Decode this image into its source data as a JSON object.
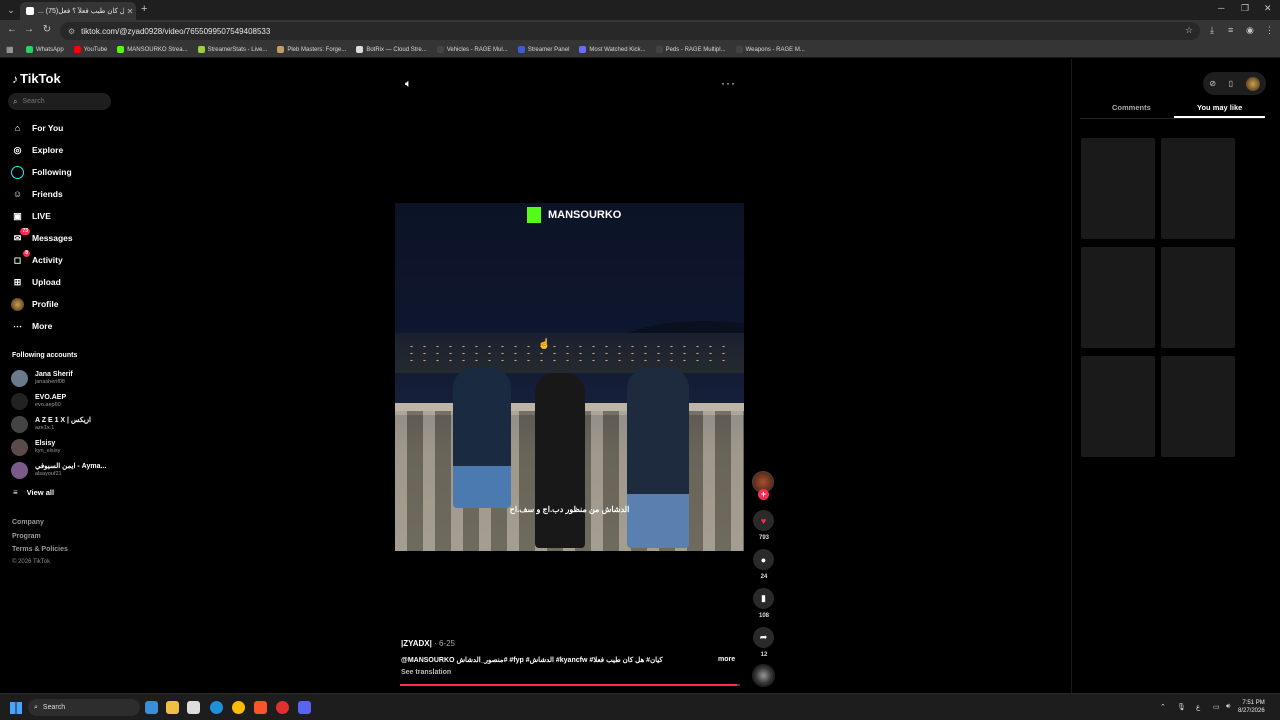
{
  "browser": {
    "tab_title": "... (75)هل كان طيب فعلاً ؟ فعل",
    "url": "tiktok.com/@zyad0928/video/7655099507549408533",
    "bookmarks": [
      {
        "label": "WhatsApp",
        "color": "#25d366"
      },
      {
        "label": "YouTube",
        "color": "#ff0000"
      },
      {
        "label": "MANSOURKO Strea...",
        "color": "#53fc18"
      },
      {
        "label": "StreamerStats - Live...",
        "color": "#9bd13a"
      },
      {
        "label": "Pleb Masters: Forge...",
        "color": "#c0a060"
      },
      {
        "label": "BotRix — Cloud Stre...",
        "color": "#dddddd"
      },
      {
        "label": "Vehicles - RAGE Mul...",
        "color": "#444444"
      },
      {
        "label": "Streamer Panel",
        "color": "#3b5bdb"
      },
      {
        "label": "Most Watched Kick...",
        "color": "#6b6bff"
      },
      {
        "label": "Peds - RAGE Multipl...",
        "color": "#444444"
      },
      {
        "label": "Weapons - RAGE M...",
        "color": "#444444"
      }
    ]
  },
  "sidebar": {
    "logo": "TikTok",
    "search_placeholder": "Search",
    "nav": [
      {
        "label": "For You",
        "icon": "home-icon"
      },
      {
        "label": "Explore",
        "icon": "compass-icon"
      },
      {
        "label": "Following",
        "icon": "following-icon"
      },
      {
        "label": "Friends",
        "icon": "friends-icon"
      },
      {
        "label": "LIVE",
        "icon": "live-icon"
      },
      {
        "label": "Messages",
        "icon": "messages-icon",
        "badge": "73"
      },
      {
        "label": "Activity",
        "icon": "activity-icon",
        "badge": "8"
      },
      {
        "label": "Upload",
        "icon": "upload-icon"
      },
      {
        "label": "Profile",
        "icon": "profile-avatar"
      },
      {
        "label": "More",
        "icon": "more-icon"
      }
    ],
    "following_title": "Following accounts",
    "accounts": [
      {
        "name": "Jana Sherif",
        "handle": "janasherif08",
        "color": "#6a7a8a"
      },
      {
        "name": "EVO.AEP",
        "handle": "evo.aep60",
        "color": "#222222"
      },
      {
        "name": "A Z E 1 X | ازيكس",
        "handle": "aze1x.1",
        "color": "#444444"
      },
      {
        "name": "Elsisy",
        "handle": "kyn_elsisy",
        "color": "#5a4a4a"
      },
      {
        "name": "ايمن السيوفي - Ayma...",
        "handle": "alsayouf21",
        "color": "#7a5a8a"
      }
    ],
    "view_all": "View all",
    "footer": [
      "Company",
      "Program",
      "Terms & Policies"
    ],
    "copyright": "© 2026 TikTok"
  },
  "video": {
    "brand": "MANSOURKO",
    "caption": "الدشاش من منظور دب.اج و سف.اح",
    "author": "|ZYADX|",
    "date": "· 6-25",
    "description": "@MANSOURKO منصور_الدشاش# #fyp #الدشاش #kyancfw #كيان# هل كان طيب فعلا",
    "more": "more",
    "see_translation": "See translation",
    "progress": 0.99
  },
  "actions": {
    "likes": "793",
    "comments": "24",
    "saves": "108",
    "shares": "12"
  },
  "panel": {
    "tabs": [
      "Comments",
      "You may like"
    ],
    "active_tab": "You may like"
  },
  "taskbar": {
    "search": "Search",
    "time": "7:51 PM",
    "date": "8/27/2026",
    "lang": "ع"
  }
}
